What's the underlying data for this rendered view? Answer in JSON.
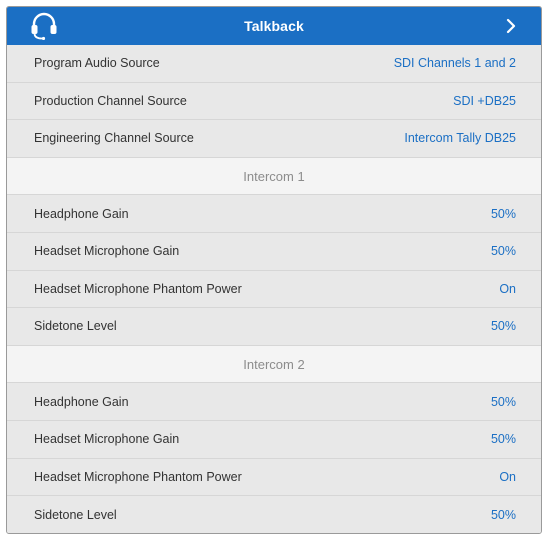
{
  "header": {
    "title": "Talkback"
  },
  "source_rows": [
    {
      "label": "Program Audio Source",
      "value": "SDI Channels 1 and 2"
    },
    {
      "label": "Production Channel Source",
      "value": "SDI +DB25"
    },
    {
      "label": "Engineering Channel Source",
      "value": "Intercom Tally DB25"
    }
  ],
  "intercom1": {
    "title": "Intercom 1",
    "rows": [
      {
        "label": "Headphone Gain",
        "value": "50%"
      },
      {
        "label": "Headset Microphone Gain",
        "value": "50%"
      },
      {
        "label": "Headset Microphone Phantom Power",
        "value": "On"
      },
      {
        "label": "Sidetone Level",
        "value": "50%"
      }
    ]
  },
  "intercom2": {
    "title": "Intercom 2",
    "rows": [
      {
        "label": "Headphone Gain",
        "value": "50%"
      },
      {
        "label": "Headset Microphone Gain",
        "value": "50%"
      },
      {
        "label": "Headset Microphone Phantom Power",
        "value": "On"
      },
      {
        "label": "Sidetone Level",
        "value": "50%"
      }
    ]
  },
  "colors": {
    "accent": "#1b6fc4",
    "row_bg": "#e8e8e8",
    "section_bg": "#f4f4f4"
  },
  "icons": {
    "header_left": "headset-icon",
    "header_right": "chevron-right-icon"
  }
}
